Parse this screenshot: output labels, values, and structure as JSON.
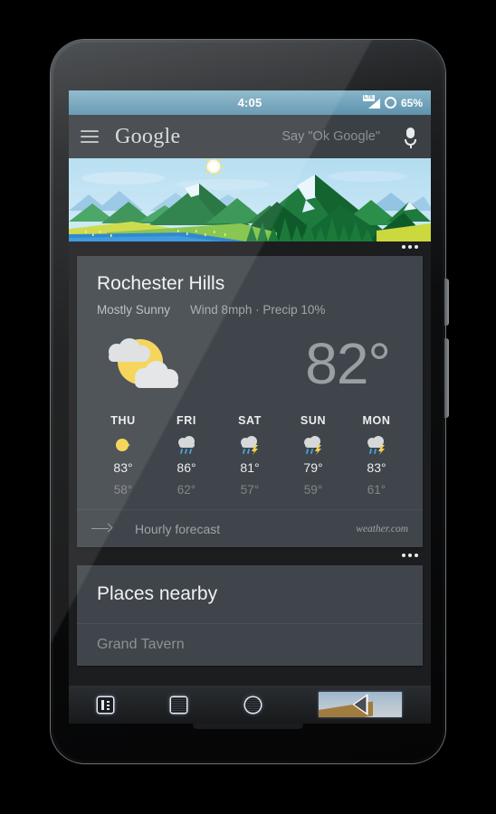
{
  "status_bar": {
    "time": "4:05",
    "network_label": "LTE",
    "battery_percent": "65%",
    "signal_icon": "signal-bars-icon",
    "battery_icon": "battery-ring-icon"
  },
  "search_bar": {
    "menu_icon": "hamburger-menu-icon",
    "brand": "Google",
    "hint": "Say \"Ok Google\"",
    "mic_icon": "microphone-icon"
  },
  "hero": {
    "image_name": "mountain-landscape-illustration",
    "sun_icon": "sun-icon",
    "sky_color": "#bfe0f0",
    "mountain_color": "#1f7a3d",
    "lake_color": "#1f7ec9",
    "meadow_color": "#7ec142"
  },
  "weather_card": {
    "overflow_icon": "overflow-dots-icon",
    "location": "Rochester Hills",
    "condition": "Mostly Sunny",
    "details": "Wind 8mph · Precip 10%",
    "current_icon": "sun-behind-clouds-icon",
    "temperature": "82°",
    "forecast": [
      {
        "day": "THU",
        "icon": "sun-icon",
        "high": "83°",
        "low": "58°"
      },
      {
        "day": "FRI",
        "icon": "rain-cloud-icon",
        "high": "86°",
        "low": "62°"
      },
      {
        "day": "SAT",
        "icon": "thunderstorm-icon",
        "high": "81°",
        "low": "57°"
      },
      {
        "day": "SUN",
        "icon": "thunderstorm-icon",
        "high": "79°",
        "low": "59°"
      },
      {
        "day": "MON",
        "icon": "thunderstorm-icon",
        "high": "83°",
        "low": "61°"
      }
    ],
    "hourly_label": "Hourly forecast",
    "hourly_arrow_icon": "arrow-right-icon",
    "attribution": "weather.com"
  },
  "places_card": {
    "overflow_icon": "overflow-dots-icon",
    "title": "Places nearby",
    "first_place": "Grand Tavern"
  },
  "nav_bar": {
    "menu_icon": "recent-apps-icon",
    "back_icon": "square-button-icon",
    "home_icon": "circle-button-icon",
    "preview_icon": "back-triangle-icon"
  },
  "colors": {
    "card_bg": "#40454b",
    "screen_bg": "#1c1d1f",
    "search_bg": "#3b4045",
    "accent_sun": "#f5d14e",
    "text_primary": "#f0f2f3",
    "text_secondary": "#a2a7ab"
  }
}
